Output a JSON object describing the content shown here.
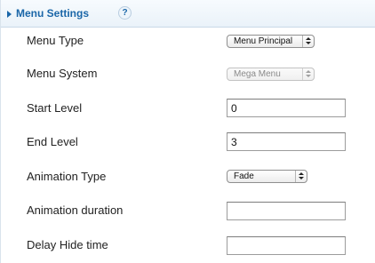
{
  "panel": {
    "title": "Menu Settings",
    "help_icon": "?"
  },
  "fields": {
    "menu_type": {
      "label": "Menu Type",
      "value": "Menu Principal"
    },
    "menu_system": {
      "label": "Menu System",
      "value": "Mega Menu",
      "disabled": true
    },
    "start_level": {
      "label": "Start Level",
      "value": "0"
    },
    "end_level": {
      "label": "End Level",
      "value": "3"
    },
    "animation_type": {
      "label": "Animation Type",
      "value": "Fade"
    },
    "animation_duration": {
      "label": "Animation duration",
      "value": ""
    },
    "delay_hide_time": {
      "label": "Delay Hide time",
      "value": ""
    }
  },
  "colors": {
    "header_text": "#1a66a8",
    "header_bg": "#eaf2f9",
    "label_text": "#222222"
  }
}
